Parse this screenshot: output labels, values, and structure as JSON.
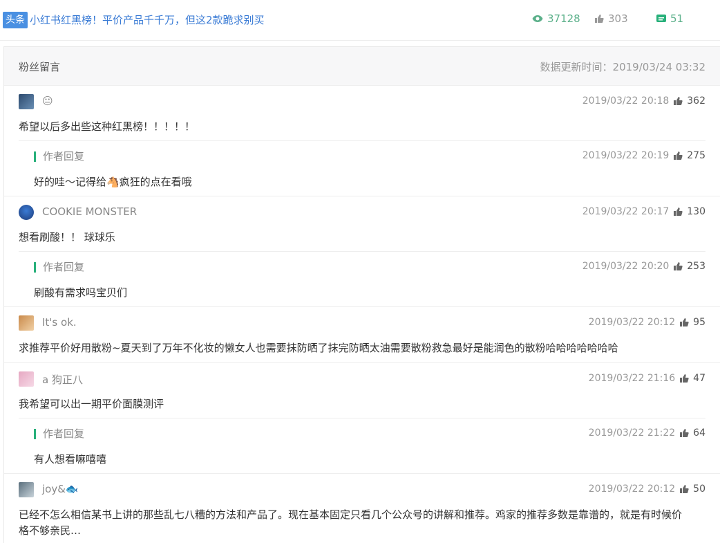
{
  "article": {
    "tag": "头条",
    "title": "小红书红黑榜！平价产品千千万，但这2款跪求别买",
    "views": "37128",
    "likes": "303",
    "comments": "51"
  },
  "panel": {
    "title": "粉丝留言",
    "updated_label": "数据更新时间：2019/03/24 03:32"
  },
  "comments": [
    {
      "user": "😐",
      "time": "2019/03/22 20:18",
      "likes": "362",
      "text": "希望以后多出些这种红黑榜！！！！！",
      "reply": {
        "label": "作者回复",
        "time": "2019/03/22 20:19",
        "likes": "275",
        "text": "好的哇～记得给🐴疯狂的点在看哦"
      }
    },
    {
      "user": "COOKIE MONSTER",
      "time": "2019/03/22 20:17",
      "likes": "130",
      "text": "想看刷酸！！ 球球乐",
      "reply": {
        "label": "作者回复",
        "time": "2019/03/22 20:20",
        "likes": "253",
        "text": "刷酸有需求吗宝贝们"
      }
    },
    {
      "user": "It's ok.",
      "time": "2019/03/22 20:12",
      "likes": "95",
      "text": "求推荐平价好用散粉~夏天到了万年不化妆的懒女人也需要抹防晒了抹完防晒太油需要散粉救急最好是能润色的散粉哈哈哈哈哈哈哈"
    },
    {
      "user": "a 狗正八",
      "time": "2019/03/22 21:16",
      "likes": "47",
      "text": "我希望可以出一期平价面膜测评",
      "reply": {
        "label": "作者回复",
        "time": "2019/03/22 21:22",
        "likes": "64",
        "text": "有人想看嘛嘻嘻"
      }
    },
    {
      "user": "joy&🐟",
      "time": "2019/03/22 20:12",
      "likes": "50",
      "text": "已经不怎么相信某书上讲的那些乱七八糟的方法和产品了。现在基本固定只看几个公众号的讲解和推荐。鸡家的推荐多数是靠谱的，就是有时候价",
      "text2": "格不够亲民…"
    }
  ],
  "colors": {
    "accent": "#27b07a",
    "tag": "#4a90e2",
    "title": "#3a7bd5"
  },
  "icons": {
    "views": "eye-icon",
    "likes": "thumbs-up-icon",
    "comments": "comment-icon"
  }
}
